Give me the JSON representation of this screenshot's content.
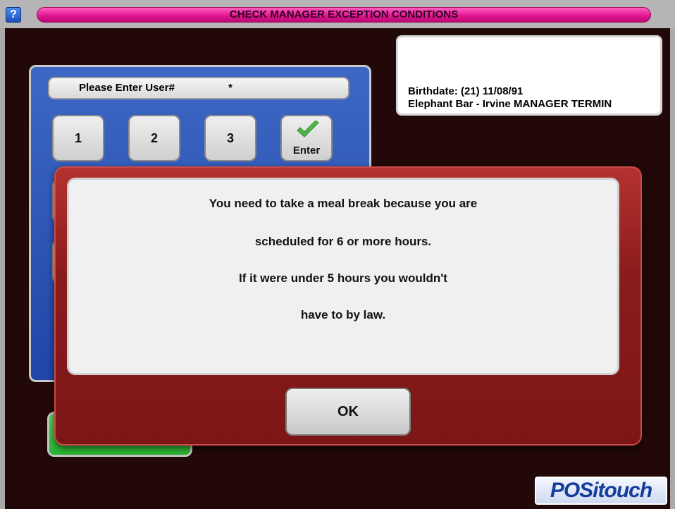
{
  "title_bar": {
    "help_label": "?",
    "title": "CHECK MANAGER EXCEPTION CONDITIONS"
  },
  "info": {
    "line1": "Birthdate: (21) 11/08/91",
    "line2": "Elephant Bar - Irvine  MANAGER TERMIN"
  },
  "keypad": {
    "user_label": "Please Enter User#",
    "user_value": "*",
    "keys": [
      "1",
      "2",
      "3"
    ],
    "enter_label": "Enter",
    "enter_icon": "checkmark-icon"
  },
  "dialog": {
    "lines": [
      "You need to take a meal break because you are",
      "scheduled for 6 or more hours.",
      "If it were under 5 hours you wouldn't",
      "have to by law."
    ],
    "ok_label": "OK"
  },
  "logo": {
    "text": "POSitouch"
  },
  "colors": {
    "title_pill": "#e0138f",
    "background": "#220808",
    "keypad": "#2a50b0",
    "dialog": "#8a1b1b",
    "green_button": "#34c23c"
  }
}
